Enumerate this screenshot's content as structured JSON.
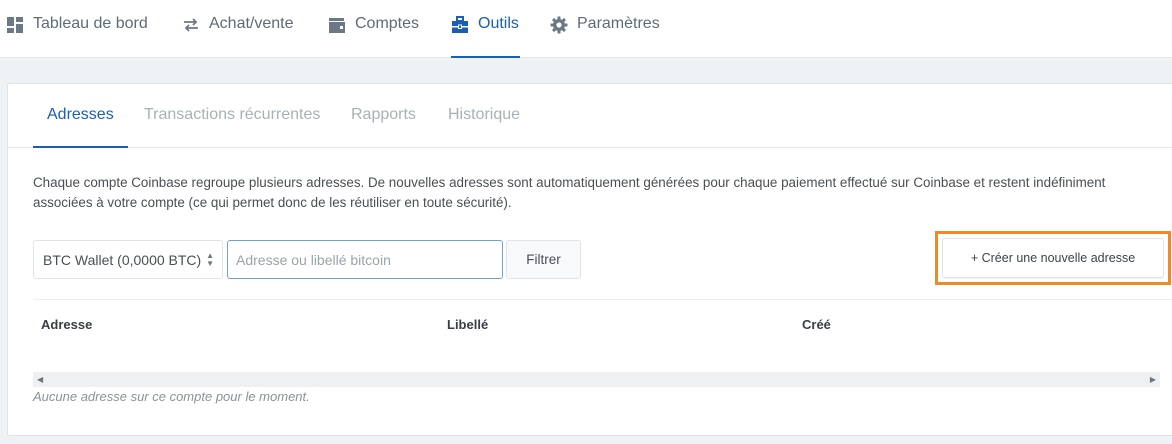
{
  "nav": {
    "dashboard": "Tableau de bord",
    "buy_sell": "Achat/vente",
    "accounts": "Comptes",
    "tools": "Outils",
    "settings": "Paramètres",
    "active": "tools"
  },
  "subtabs": {
    "addresses": "Adresses",
    "recurring": "Transactions récurrentes",
    "reports": "Rapports",
    "history": "Historique",
    "active": "addresses"
  },
  "description": "Chaque compte Coinbase regroupe plusieurs adresses. De nouvelles adresses sont automatiquement générées pour chaque paiement effectué sur Coinbase et restent indéfiniment associées à votre compte (ce qui permet donc de les réutiliser en toute sécurité).",
  "filters": {
    "wallet_selected": "BTC Wallet (0,0000 BTC)",
    "search_placeholder": "Adresse ou libellé bitcoin",
    "search_value": "",
    "filter_button": "Filtrer"
  },
  "create_button": "+ Créer une nouvelle adresse",
  "table": {
    "columns": [
      "Adresse",
      "Libellé",
      "Créé"
    ],
    "empty_message": "Aucune adresse sur ce compte pour le moment."
  },
  "colors": {
    "accent": "#1a5fb4",
    "highlight": "#f08a24",
    "background": "#eef2f5"
  },
  "icons": {
    "dashboard": "dashboard-grid-icon",
    "buy_sell": "exchange-arrows-icon",
    "accounts": "wallet-icon",
    "tools": "toolbox-icon",
    "settings": "gear-icon"
  }
}
